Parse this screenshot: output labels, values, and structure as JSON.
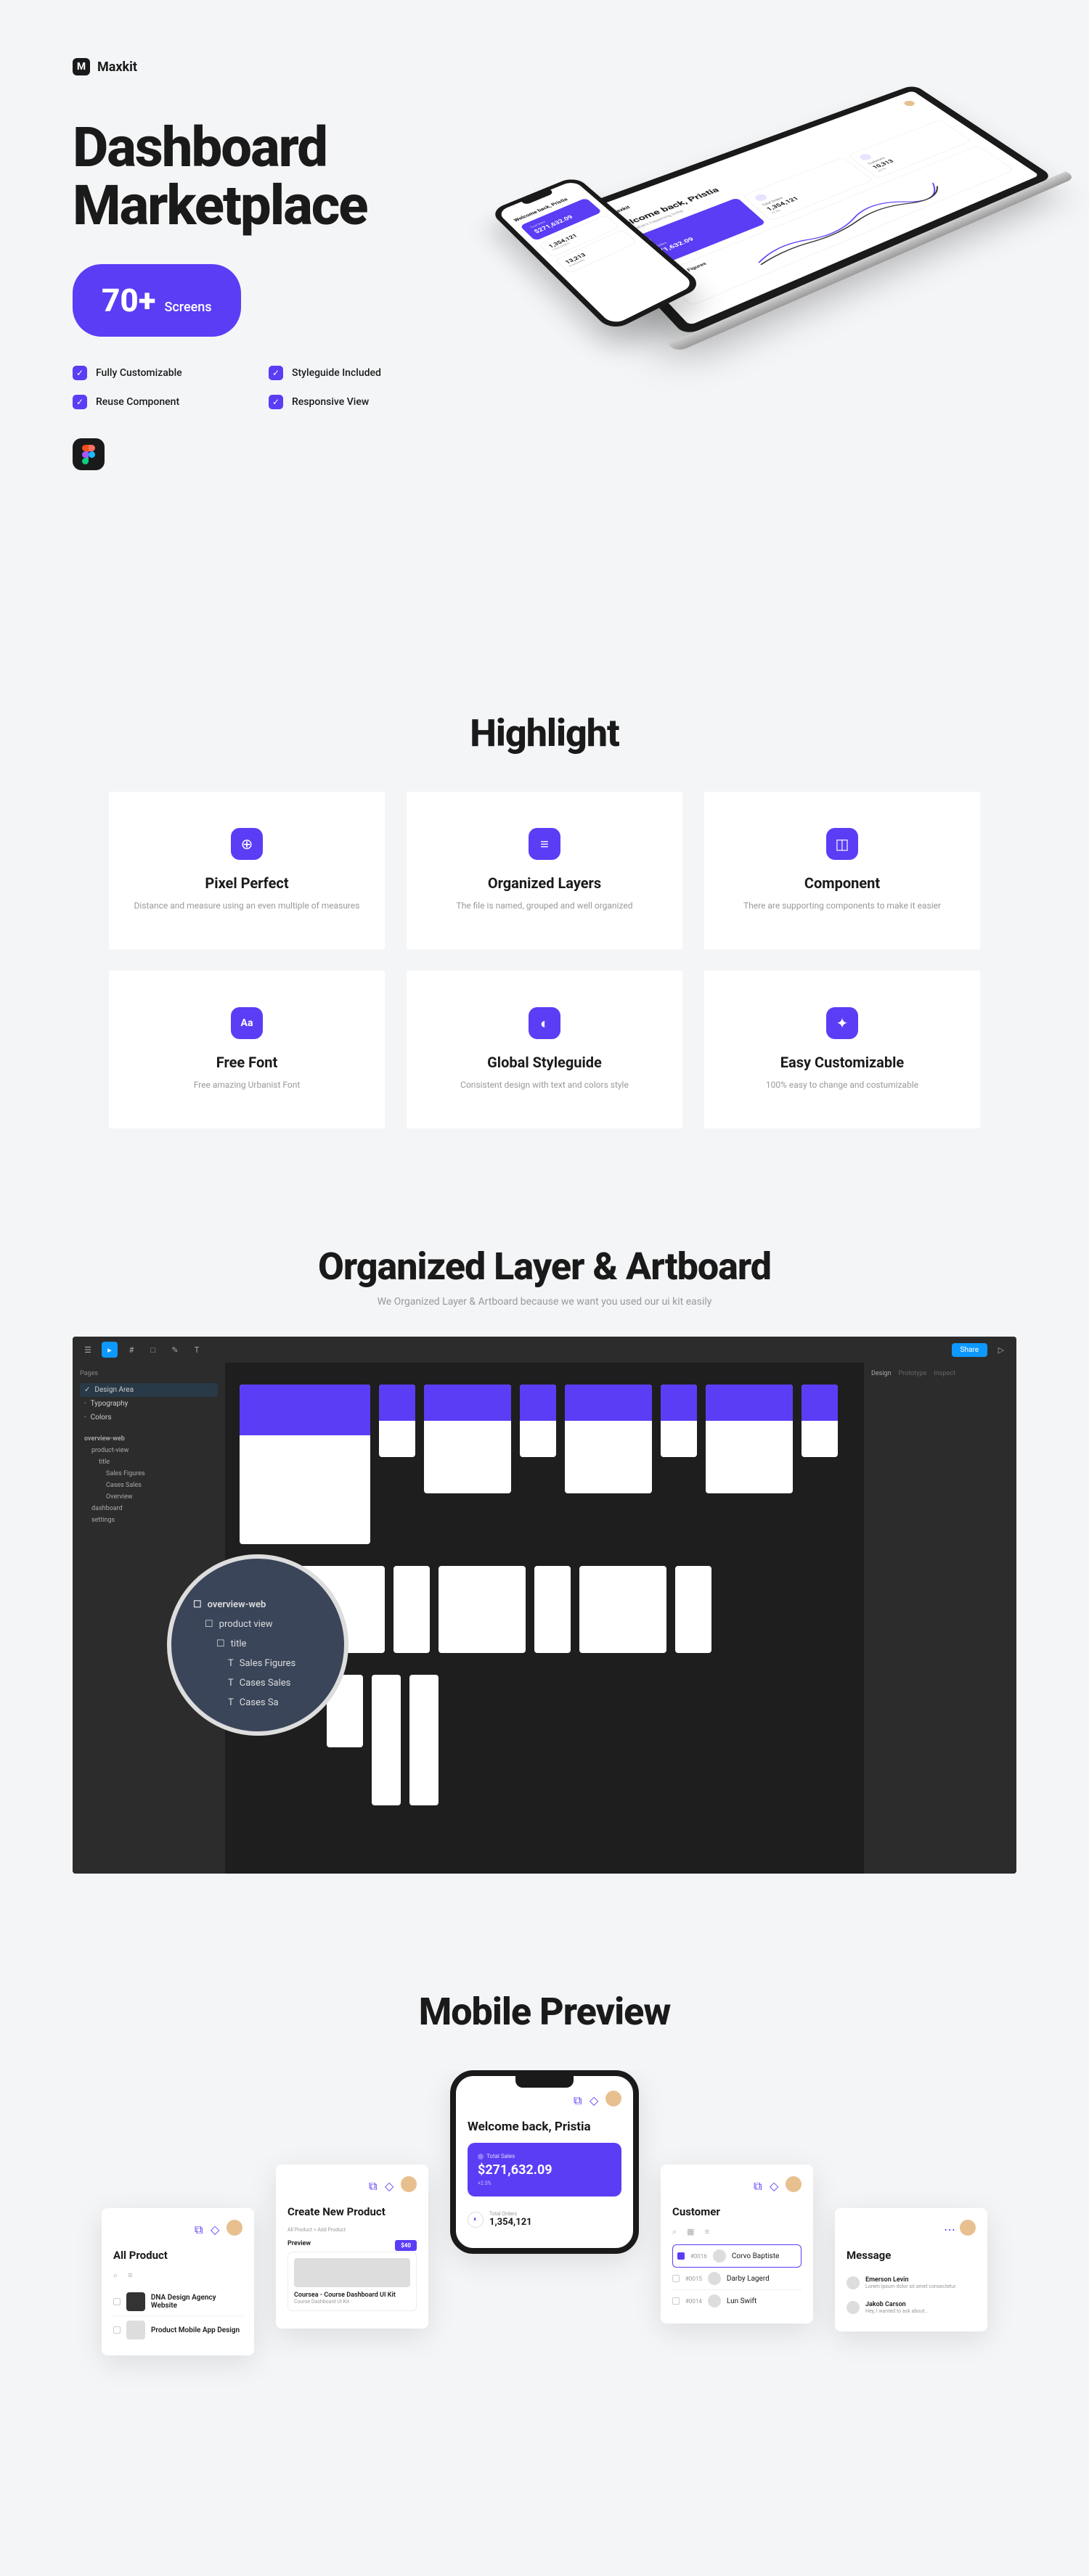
{
  "brand": {
    "name": "Maxkit",
    "mark": "M"
  },
  "hero": {
    "title_line1": "Dashboard",
    "title_line2": "Marketplace",
    "screens_count": "70+",
    "screens_label": "Screens",
    "features": [
      "Fully Customizable",
      "Styleguide Included",
      "Reuse Component",
      "Responsive View"
    ]
  },
  "dashboard_preview": {
    "welcome": "Welcome back, Pristia",
    "subtitle": "Here's what's happening today",
    "cards": [
      {
        "label": "Total Sales",
        "value": "$271,632.09",
        "change": "+2.5%"
      },
      {
        "label": "Total Orders",
        "value": "1,354,121",
        "change": "+1.7%"
      },
      {
        "label": "Customers",
        "value": "10,313",
        "change": "+2.1%"
      }
    ],
    "chart_title": "Sales Figures"
  },
  "phone_preview": {
    "welcome": "Welcome back, Pristia",
    "card_label": "Total Sales",
    "card_value": "$271,632.09",
    "stats": [
      {
        "value": "1,354,121",
        "label": "Total Orders"
      },
      {
        "value": "13,213",
        "label": "Customers"
      }
    ]
  },
  "highlight": {
    "title": "Highlight",
    "cards": [
      {
        "icon": "⊕",
        "title": "Pixel Perfect",
        "desc": "Distance and measure using an even multiple of measures"
      },
      {
        "icon": "≡",
        "title": "Organized Layers",
        "desc": "The file is named, grouped and well organized"
      },
      {
        "icon": "◫",
        "title": "Component",
        "desc": "There are supporting components to make it easier"
      },
      {
        "icon": "Aa",
        "title": "Free Font",
        "desc": "Free amazing Urbanist Font"
      },
      {
        "icon": "◐",
        "title": "Global Styleguide",
        "desc": "Consistent design with text and colors style"
      },
      {
        "icon": "✦",
        "title": "Easy Customizable",
        "desc": "100% easy to change and costumizable"
      }
    ]
  },
  "organized": {
    "title": "Organized Layer & Artboard",
    "subtitle": "We Organized Layer & Artboard because we want you used our ui kit easily"
  },
  "figma": {
    "share": "Share",
    "pages_label": "Pages",
    "pages": [
      "Design Area",
      "Typography",
      "Colors"
    ],
    "layers_section": "overview-web",
    "layers": [
      "product-view",
      "title",
      "Sales Figures",
      "Cases Sales",
      "Overview",
      "dashboard",
      "settings"
    ],
    "zoom_items": [
      "overview-web",
      "product view",
      "title",
      "Sales Figures",
      "Cases Sales",
      "Cases Sa"
    ],
    "right_panel": [
      "Design",
      "Prototype",
      "Inspect"
    ]
  },
  "mobile": {
    "title": "Mobile Preview",
    "center": {
      "welcome": "Welcome back, Pristia",
      "card_label": "Total Sales",
      "card_value": "$271,632.09",
      "card_change": "+2.5%",
      "stat_label": "Total Orders",
      "stat_value": "1,354,121"
    },
    "left_side": {
      "title": "Create New Product",
      "breadcrumb": "All Product  >  Add Product",
      "preview_label": "Preview",
      "price": "$40",
      "product_name": "Coursea - Course Dashboard UI Kit",
      "product_sub": "Course Dashboard UI Kit"
    },
    "left_far": {
      "title": "All Product",
      "items": [
        "DNA Design Agency Website",
        "Product Mobile App Design"
      ]
    },
    "right_side": {
      "title": "Customer",
      "customers": [
        "Corvo Baptiste",
        "Darby Lagerd",
        "Lun Swift"
      ],
      "ids": [
        "#0016",
        "#0015",
        "#0014"
      ]
    },
    "right_far": {
      "title": "Message",
      "messages": [
        {
          "name": "Emerson Levin",
          "preview": "Lorem ipsum dolor sit amet consectetur"
        },
        {
          "name": "Jakob Carson",
          "preview": "Hey, I wanted to ask about..."
        }
      ]
    }
  }
}
